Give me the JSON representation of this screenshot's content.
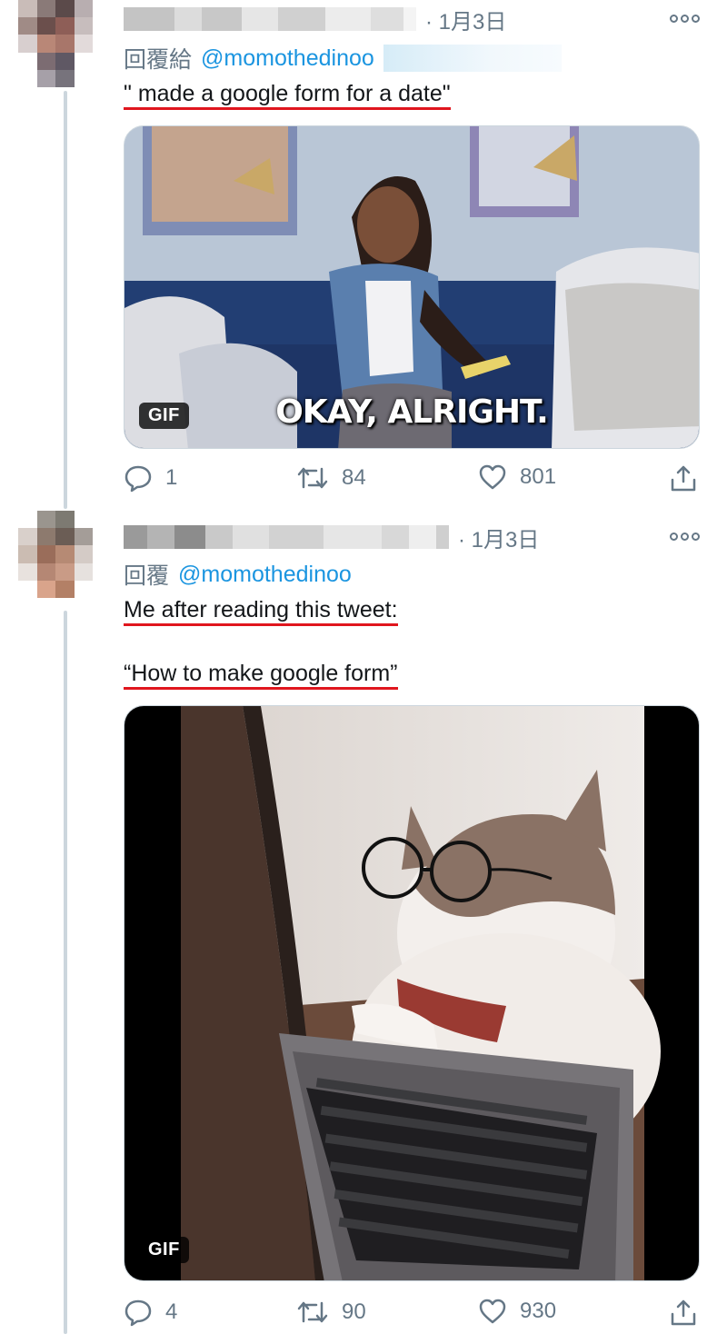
{
  "tweets": [
    {
      "time": "· 1月3日",
      "reply_prefix": "回覆給",
      "reply_handle": "@momothedinoo",
      "text_lines": [
        "\" made a google form for a date\""
      ],
      "media": {
        "badge": "GIF",
        "caption": "OKAY, ALRIGHT."
      },
      "actions": {
        "replies": "1",
        "retweets": "84",
        "likes": "801"
      }
    },
    {
      "time": "· 1月3日",
      "reply_prefix": "回覆",
      "reply_handle": "@momothedinoo",
      "text_lines": [
        "Me after reading this tweet:",
        "“How to make google form”"
      ],
      "media": {
        "badge": "GIF"
      },
      "actions": {
        "replies": "4",
        "retweets": "90",
        "likes": "930"
      }
    }
  ],
  "colors": {
    "accent": "#1b95e0",
    "underline": "#e0161e",
    "secondary_text": "#657786",
    "thread_line": "#ccd6dd"
  },
  "icons": [
    "more-icon",
    "reply-icon",
    "retweet-icon",
    "like-icon",
    "share-icon"
  ]
}
